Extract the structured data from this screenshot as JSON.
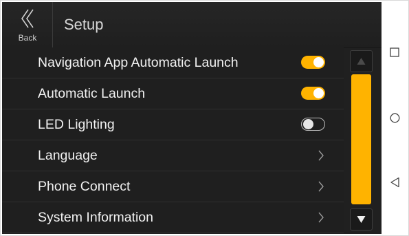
{
  "header": {
    "back_label": "Back",
    "title": "Setup"
  },
  "settings": [
    {
      "label": "Navigation App Automatic Launch",
      "control": "toggle",
      "state": "on"
    },
    {
      "label": "Automatic Launch",
      "control": "toggle",
      "state": "on"
    },
    {
      "label": "LED Lighting",
      "control": "toggle",
      "state": "off"
    },
    {
      "label": "Language",
      "control": "chevron-right-icon"
    },
    {
      "label": "Phone Connect",
      "control": "chevron-right-icon"
    },
    {
      "label": "System Information",
      "control": "chevron-right-icon"
    }
  ],
  "scrollbar": {
    "up_icon": "up-arrow-icon",
    "down_icon": "down-arrow-icon"
  },
  "system_nav": [
    "recents-square-icon",
    "home-circle-icon",
    "back-triangle-icon"
  ],
  "colors": {
    "accent": "#ffb300",
    "background": "#202020",
    "text": "#f2f2f2"
  }
}
